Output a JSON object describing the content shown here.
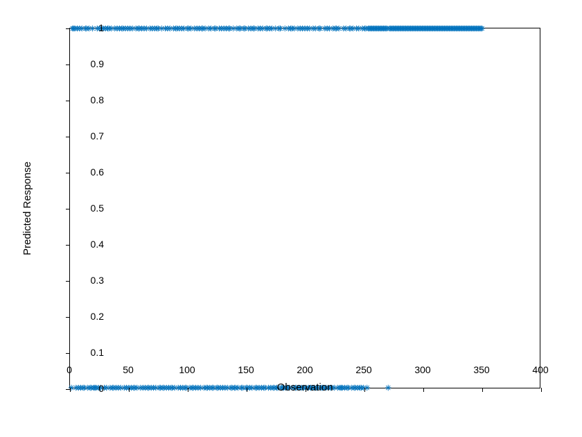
{
  "chart_data": {
    "type": "scatter",
    "title": "",
    "xlabel": "Observation",
    "ylabel": "Predicted Response",
    "xlim": [
      0,
      400
    ],
    "ylim": [
      0,
      1
    ],
    "xticks": [
      0,
      50,
      100,
      150,
      200,
      250,
      300,
      350,
      400
    ],
    "yticks": [
      0,
      0.1,
      0.2,
      0.3,
      0.4,
      0.5,
      0.6,
      0.7,
      0.8,
      0.9,
      1
    ],
    "marker": "star",
    "color": "#0072bd",
    "series": [
      {
        "name": "Predicted Response",
        "x": [
          1,
          2,
          3,
          4,
          5,
          6,
          7,
          8,
          9,
          10,
          11,
          12,
          13,
          14,
          15,
          16,
          17,
          18,
          19,
          20,
          21,
          22,
          23,
          24,
          25,
          26,
          27,
          28,
          29,
          30,
          31,
          32,
          33,
          34,
          35,
          36,
          37,
          38,
          39,
          40,
          41,
          42,
          43,
          44,
          45,
          46,
          47,
          48,
          49,
          50,
          51,
          52,
          53,
          54,
          55,
          56,
          57,
          58,
          59,
          60,
          61,
          62,
          63,
          64,
          65,
          66,
          67,
          68,
          69,
          70,
          71,
          72,
          73,
          74,
          75,
          76,
          77,
          78,
          79,
          80,
          81,
          82,
          83,
          84,
          85,
          86,
          87,
          88,
          89,
          90,
          91,
          92,
          93,
          94,
          95,
          96,
          97,
          98,
          99,
          100,
          101,
          102,
          103,
          104,
          105,
          106,
          107,
          108,
          109,
          110,
          111,
          112,
          113,
          114,
          115,
          116,
          117,
          118,
          119,
          120,
          121,
          122,
          123,
          124,
          125,
          126,
          127,
          128,
          129,
          130,
          131,
          132,
          133,
          134,
          135,
          136,
          137,
          138,
          139,
          140,
          141,
          142,
          143,
          144,
          145,
          146,
          147,
          148,
          149,
          150,
          151,
          152,
          153,
          154,
          155,
          156,
          157,
          158,
          159,
          160,
          161,
          162,
          163,
          164,
          165,
          166,
          167,
          168,
          169,
          170,
          171,
          172,
          173,
          174,
          175,
          176,
          177,
          178,
          179,
          180,
          181,
          182,
          183,
          184,
          185,
          186,
          187,
          188,
          189,
          190,
          191,
          192,
          193,
          194,
          195,
          196,
          197,
          198,
          199,
          200,
          201,
          202,
          203,
          204,
          205,
          206,
          207,
          208,
          209,
          210,
          211,
          212,
          213,
          214,
          215,
          216,
          217,
          218,
          219,
          220,
          221,
          222,
          223,
          224,
          225,
          226,
          227,
          228,
          229,
          230,
          231,
          232,
          233,
          234,
          235,
          236,
          237,
          238,
          239,
          240,
          241,
          242,
          243,
          244,
          245,
          246,
          247,
          248,
          249,
          250,
          251,
          252,
          253,
          254,
          255,
          256,
          257,
          258,
          259,
          260,
          261,
          262,
          263,
          264,
          265,
          266,
          267,
          268,
          269,
          270,
          271,
          272,
          273,
          274,
          275,
          276,
          277,
          278,
          279,
          280,
          281,
          282,
          283,
          284,
          285,
          286,
          287,
          288,
          289,
          290,
          291,
          292,
          293,
          294,
          295,
          296,
          297,
          298,
          299,
          300,
          301,
          302,
          303,
          304,
          305,
          306,
          307,
          308,
          309,
          310,
          311,
          312,
          313,
          314,
          315,
          316,
          317,
          318,
          319,
          320,
          321,
          322,
          323,
          324,
          325,
          326,
          327,
          328,
          329,
          330,
          331,
          332,
          333,
          334,
          335,
          336,
          337,
          338,
          339,
          340,
          341,
          342,
          343,
          344,
          345,
          346,
          347,
          348,
          349,
          350,
          351
        ],
        "y": [
          0,
          1,
          1,
          1,
          0,
          1,
          0,
          1,
          0,
          1,
          0,
          0,
          1,
          1,
          0,
          1,
          0,
          0,
          1,
          0,
          0,
          0,
          1,
          0,
          1,
          0,
          1,
          1,
          0,
          1,
          0,
          1,
          1,
          0,
          1,
          0,
          0,
          1,
          0,
          1,
          0,
          1,
          0,
          1,
          1,
          0,
          1,
          0,
          1,
          0,
          1,
          0,
          1,
          0,
          0,
          1,
          0,
          1,
          1,
          0,
          1,
          0,
          1,
          0,
          1,
          0,
          0,
          1,
          0,
          1,
          0,
          1,
          0,
          1,
          1,
          0,
          0,
          1,
          0,
          0,
          1,
          0,
          1,
          0,
          1,
          0,
          0,
          1,
          0,
          1,
          1,
          0,
          1,
          0,
          1,
          0,
          1,
          0,
          0,
          1,
          1,
          0,
          1,
          0,
          0,
          1,
          0,
          1,
          0,
          1,
          0,
          1,
          1,
          0,
          1,
          0,
          0,
          1,
          0,
          1,
          0,
          0,
          1,
          1,
          0,
          0,
          1,
          0,
          1,
          0,
          1,
          0,
          1,
          0,
          1,
          1,
          0,
          0,
          1,
          0,
          0,
          1,
          0,
          1,
          1,
          0,
          0,
          1,
          1,
          0,
          0,
          1,
          0,
          1,
          0,
          1,
          1,
          0,
          0,
          1,
          0,
          1,
          0,
          1,
          0,
          0,
          1,
          1,
          0,
          1,
          0,
          1,
          0,
          0,
          1,
          0,
          0,
          1,
          1,
          0,
          0,
          0,
          1,
          0,
          0,
          1,
          0,
          1,
          1,
          0,
          1,
          0,
          0,
          1,
          0,
          1,
          0,
          1,
          0,
          1,
          0,
          1,
          0,
          1,
          0,
          0,
          1,
          0,
          1,
          0,
          0,
          1,
          1,
          0,
          0,
          0,
          1,
          0,
          1,
          0,
          1,
          0,
          0,
          1,
          0,
          1,
          1,
          0,
          1,
          0,
          0,
          0,
          1,
          0,
          1,
          0,
          0,
          1,
          1,
          0,
          1,
          0,
          0,
          1,
          0,
          1,
          0,
          0,
          1,
          0,
          1,
          1,
          0,
          1,
          1,
          1,
          1,
          1,
          1,
          1,
          1,
          1,
          1,
          1,
          1,
          1,
          1,
          1,
          1,
          1,
          0,
          1,
          1,
          1,
          1,
          1,
          1,
          1,
          1,
          1,
          1,
          1,
          1,
          1,
          1,
          1,
          1,
          1,
          1,
          1,
          1,
          1,
          1,
          1,
          1,
          1,
          1,
          1,
          1,
          1,
          1,
          1,
          1,
          1,
          1,
          1,
          1,
          1,
          1,
          1,
          1,
          1,
          1,
          1,
          1,
          1,
          1,
          1,
          1,
          1,
          1,
          1,
          1,
          1,
          1,
          1,
          1,
          1,
          1,
          1,
          1,
          1,
          1,
          1,
          1,
          1,
          1,
          1,
          1,
          1,
          1,
          1,
          1,
          1,
          1,
          1,
          1,
          1,
          1,
          1,
          1
        ]
      }
    ]
  }
}
